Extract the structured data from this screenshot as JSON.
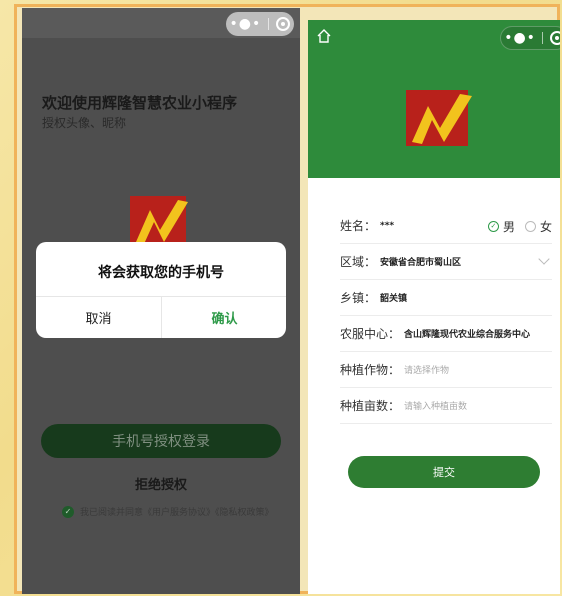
{
  "left": {
    "welcome_title": "欢迎使用辉隆智慧农业小程序",
    "welcome_sub": "授权头像、昵称",
    "dialog": {
      "title": "将会获取您的手机号",
      "cancel": "取消",
      "confirm": "确认"
    },
    "login_button": "手机号授权登录",
    "refuse": "拒绝授权",
    "agreement": "我已阅读并同意《用户服务协议》《隐私权政策》",
    "capsule_icons": [
      "more-dots-icon",
      "close-target-icon"
    ]
  },
  "right": {
    "form": {
      "name_label": "姓名：",
      "name_value": "***",
      "gender_male": "男",
      "gender_female": "女",
      "gender_selected": "男",
      "region_label": "区域：",
      "region_value": "安徽省合肥市蜀山区",
      "town_label": "乡镇：",
      "town_value": "韶关镇",
      "center_label": "农服中心：",
      "center_value": "含山辉隆现代农业综合服务中心",
      "crop_label": "种植作物：",
      "crop_placeholder": "请选择作物",
      "area_label": "种植亩数：",
      "area_placeholder": "请输入种植亩数"
    },
    "submit": "提交",
    "icons": [
      "home-icon",
      "more-dots-icon",
      "close-target-icon",
      "chevron-down-icon"
    ]
  },
  "colors": {
    "brand_green": "#2e8b3b",
    "button_green": "#2e7d32",
    "logo_red": "#b8211b",
    "logo_yellow": "#f2c31d",
    "frame_orange": "#f0b35a"
  }
}
